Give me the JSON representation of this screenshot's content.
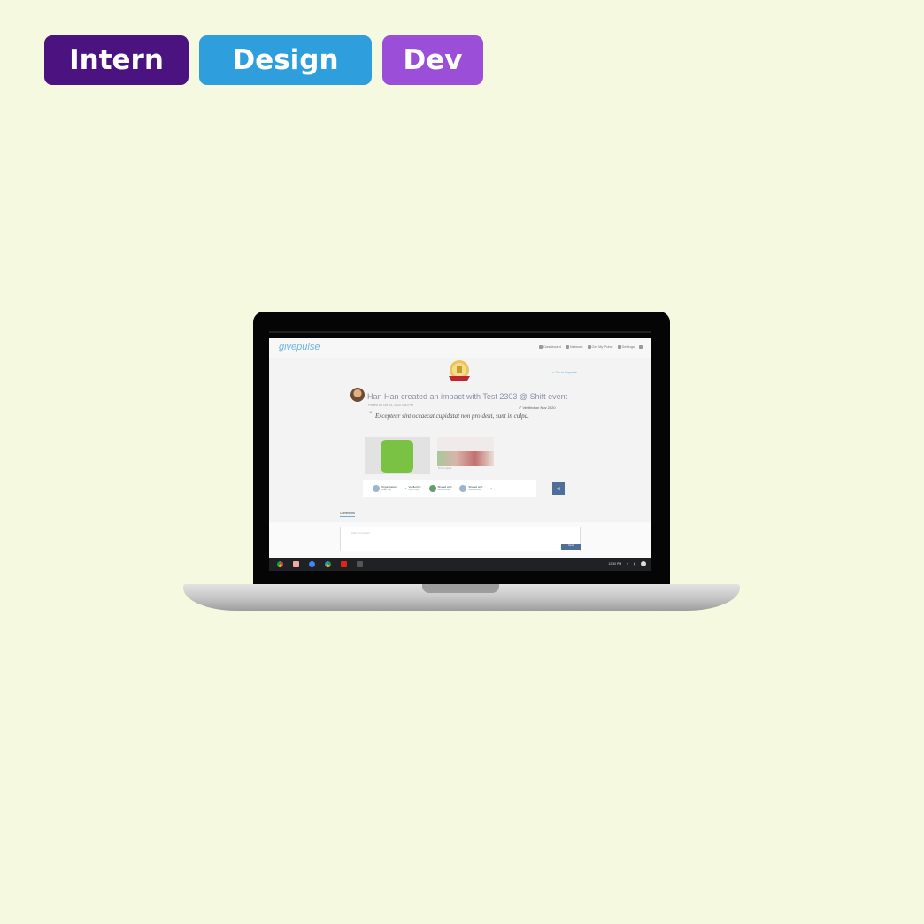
{
  "tags": {
    "intern": "Intern",
    "design": "Design",
    "dev": "Dev"
  },
  "screen": {
    "logo": "givepulse",
    "nav": [
      "Dashboard",
      "Network",
      "Get My Pulse",
      "Settings"
    ],
    "back_link": "< Go to impacts",
    "headline": "Han Han created an impact with Test 2303 @ Shift event",
    "posted": "Posted on Oct 24, 2020 3:30 PM",
    "verified": "Verified on Nov 2020",
    "quote": "Excepteur sint occaecat cupidatat non proident, sunt in culpa.",
    "photo_caption": "Photo caption",
    "stats": [
      {
        "label": "Organization",
        "sub": "Open Org"
      },
      {
        "label": "Verified by",
        "sub": "Open Org"
      },
      {
        "label": "Shared with",
        "sub": "Giving Group"
      },
      {
        "label": "Shared with",
        "sub": "Giving Group"
      }
    ],
    "comments_tab": "Comments",
    "comment_placeholder": "Add a comment",
    "send_label": "Send",
    "clock": "12:30 PM"
  },
  "colors": {
    "background": "#f5f9df",
    "intern": "#4a137f",
    "design": "#2e9fdc",
    "dev": "#9b4fd9"
  },
  "icons": [
    "chrome-icon",
    "gmail-icon",
    "docs-icon",
    "drive-icon",
    "youtube-icon",
    "apps-icon",
    "share-icon",
    "badge-icon"
  ]
}
